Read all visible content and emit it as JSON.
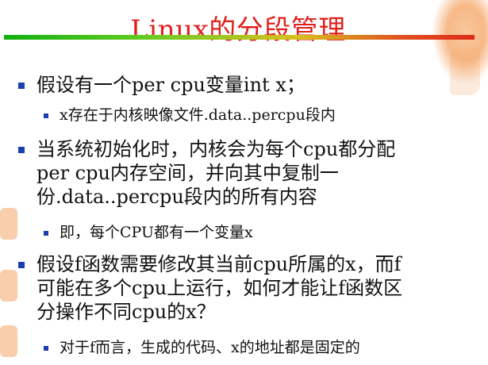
{
  "title": "Linux的分段管理",
  "bullets": [
    {
      "level": 1,
      "lines": [
        "假设有一个per cpu变量int x；"
      ]
    },
    {
      "level": 2,
      "lines": [
        "x存在于内核映像文件.data..percpu段内"
      ]
    },
    {
      "level": 1,
      "lines": [
        "当系统初始化时，内核会为每个cpu都分配",
        "per cpu内存空间，并向其中复制一",
        "份.data..percpu段内的所有内容"
      ]
    },
    {
      "level": 2,
      "lines": [
        "即，每个CPU都有一个变量x"
      ]
    },
    {
      "level": 1,
      "lines": [
        "假设f函数需要修改其当前cpu所属的x，而f",
        "可能在多个cpu上运行，如何才能让f函数区",
        "分操作不同cpu的x？"
      ]
    },
    {
      "level": 2,
      "lines": [
        "对于f而言，生成的代码、x的地址都是固定的"
      ]
    }
  ],
  "colors": {
    "title": "#e0201b",
    "bullet": "#1a3fb0",
    "text": "#111111"
  }
}
